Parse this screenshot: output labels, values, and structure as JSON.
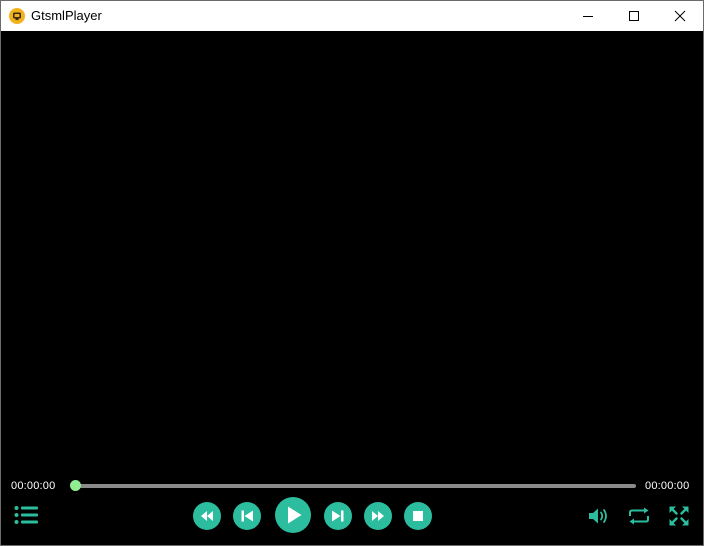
{
  "window": {
    "title": "GtsmlPlayer"
  },
  "player": {
    "current_time": "00:00:00",
    "total_time": "00:00:00",
    "progress": 0
  },
  "controls": {
    "playlist": "list-icon",
    "rewind": "rewind-icon",
    "previous": "skip-previous-icon",
    "play": "play-icon",
    "next": "skip-next-icon",
    "fast_forward": "fast-forward-icon",
    "stop": "stop-icon",
    "volume": "volume-icon",
    "loop": "repeat-icon",
    "fullscreen": "fullscreen-icon"
  },
  "colors": {
    "accent": "#2bbd9e",
    "progress_handle": "#90ee90",
    "video_background": "#000000"
  }
}
